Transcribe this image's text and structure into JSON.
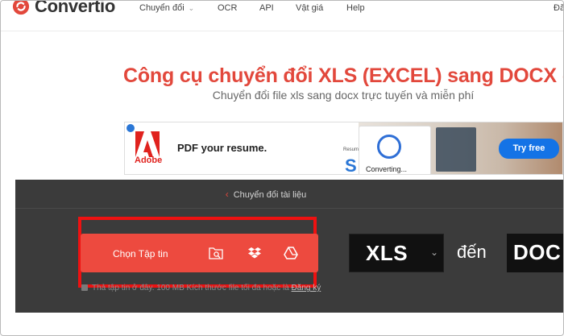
{
  "brand": {
    "name": "Convertio"
  },
  "nav": {
    "items": [
      "Chuyển đổi",
      "OCR",
      "API",
      "Vật giá",
      "Help"
    ],
    "right_cut": "Đă"
  },
  "heading": {
    "title": "Công cụ chuyển đổi XLS (EXCEL) sang DOCX (WORD)",
    "subtitle": "Chuyển đổi file xls sang docx trực tuyến và miễn phí"
  },
  "ad": {
    "brand": "Adobe",
    "headline": "PDF your resume.",
    "status": "Converting...",
    "side_label": "Resum",
    "side_letter": "S",
    "button": "Try free"
  },
  "converter": {
    "back_link": "Chuyển đổi tài liệu",
    "upload_label": "Chọn Tập tin",
    "hint": "Thả tập tin ở đây. 100 MB Kích thước file tối đa hoặc là",
    "hint_link": "Đăng ký",
    "from_format": "XLS",
    "to_word": "đến",
    "to_format": "DOC"
  },
  "colors": {
    "brand_red": "#e2483c",
    "button_red": "#ed4a3f",
    "highlight": "#ee1111",
    "panel": "#3b3b3b"
  },
  "icons": [
    "convertio-logo-icon",
    "chevron-down-icon",
    "folder-search-icon",
    "dropbox-icon",
    "google-drive-icon",
    "lock-icon",
    "chevron-left-icon"
  ]
}
